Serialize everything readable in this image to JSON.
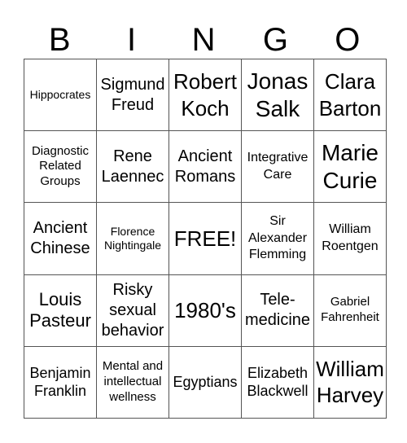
{
  "header": [
    "B",
    "I",
    "N",
    "G",
    "O"
  ],
  "cells": [
    [
      "Hippocrates",
      "Sigmund Freud",
      "Robert Koch",
      "Jonas Salk",
      "Clara Barton"
    ],
    [
      "Diagnostic Related Groups",
      "Rene Laennec",
      "Ancient Romans",
      "Integrative Care",
      "Marie Curie"
    ],
    [
      "Ancient Chinese",
      "Florence Nightingale",
      "FREE!",
      "Sir Alexander Flemming",
      "William Roentgen"
    ],
    [
      "Louis Pasteur",
      "Risky sexual behavior",
      "1980's",
      "Tele-medicine",
      "Gabriel Fahrenheit"
    ],
    [
      "Benjamin Franklin",
      "Mental and intellectual wellness",
      "Egyptians",
      "Elizabeth Blackwell",
      "William Harvey"
    ]
  ]
}
